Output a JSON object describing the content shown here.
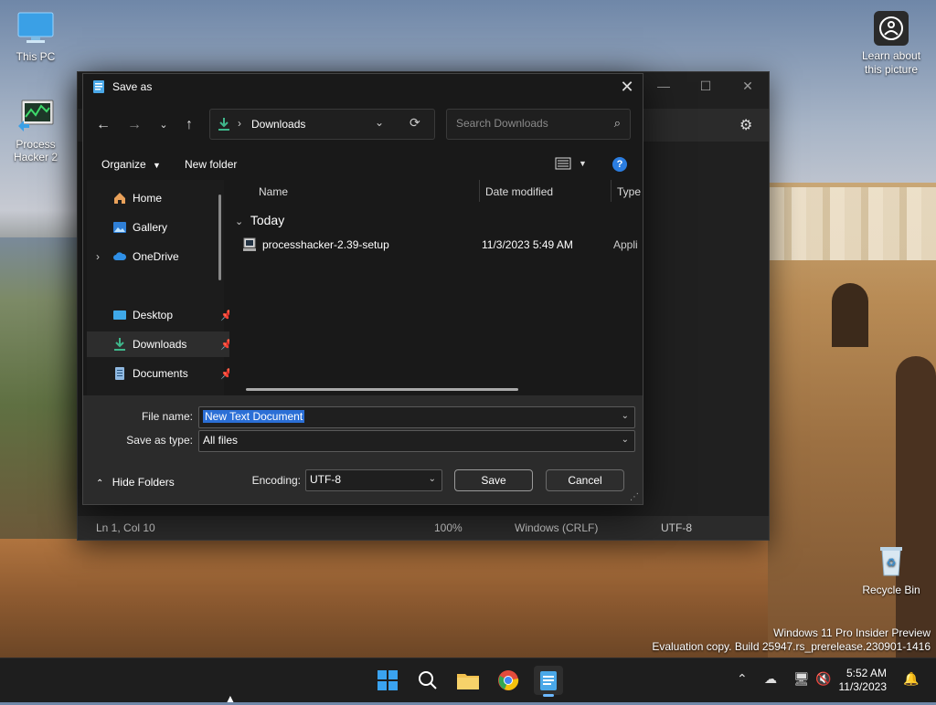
{
  "desktop": {
    "icons": [
      {
        "label": "This PC"
      },
      {
        "label": "Process Hacker 2"
      },
      {
        "label": "Recycle Bin"
      }
    ],
    "learn_about": "Learn about this picture",
    "watermark_line1": "Windows 11 Pro Insider Preview",
    "watermark_line2": "Evaluation copy. Build 25947.rs_prerelease.230901-1416"
  },
  "notepad": {
    "status": {
      "position": "Ln 1, Col 10",
      "zoom": "100%",
      "line_ending": "Windows (CRLF)",
      "encoding": "UTF-8"
    }
  },
  "dialog": {
    "title": "Save as",
    "address_path": "Downloads",
    "search_placeholder": "Search Downloads",
    "organize_label": "Organize",
    "new_folder_label": "New folder",
    "help_glyph": "?",
    "nav_items": [
      {
        "label": "Home",
        "icon": "home-icon"
      },
      {
        "label": "Gallery",
        "icon": "gallery-icon"
      },
      {
        "label": "OneDrive",
        "icon": "onedrive-icon"
      },
      {
        "label": "Desktop",
        "icon": "desktop-folder-icon"
      },
      {
        "label": "Downloads",
        "icon": "downloads-folder-icon"
      },
      {
        "label": "Documents",
        "icon": "documents-folder-icon"
      }
    ],
    "columns": {
      "name": "Name",
      "date": "Date modified",
      "type": "Type"
    },
    "group_label": "Today",
    "files": [
      {
        "name": "processhacker-2.39-setup",
        "date": "11/3/2023 5:49 AM",
        "type": "Appli"
      }
    ],
    "file_name_label": "File name:",
    "file_name_value": "New Text Document",
    "save_type_label": "Save as type:",
    "save_type_value": "All files",
    "hide_folders_label": "Hide Folders",
    "encoding_label": "Encoding:",
    "encoding_value": "UTF-8",
    "save_label": "Save",
    "cancel_label": "Cancel"
  },
  "taskbar": {
    "time": "5:52 AM",
    "date": "11/3/2023"
  },
  "colors": {
    "accent": "#2b6fd6",
    "help_blue": "#2b7de0",
    "indicator": "#6cb8ff"
  }
}
